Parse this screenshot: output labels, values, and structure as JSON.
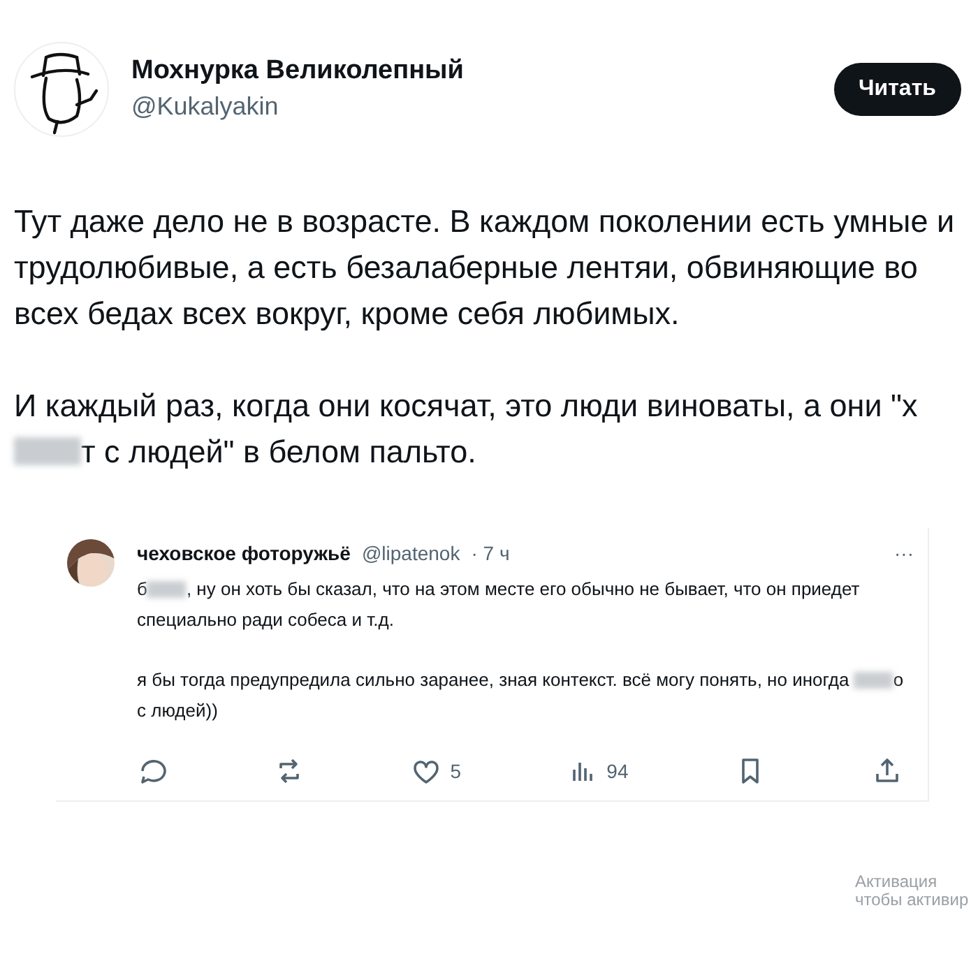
{
  "post": {
    "author": "Мохнурка Великолепный",
    "handle": "@Kukalyakin",
    "follow_button": "Читать",
    "paragraphs": [
      [
        {
          "kind": "text",
          "text": "Тут даже дело не в возрасте. В каждом поколении есть умные и трудолюбивые, а есть безалаберные лентяи, обвиняющие во всех бедах всех вокруг, кроме себя любимых."
        }
      ],
      [
        {
          "kind": "text",
          "text": "И каждый раз, когда они косячат, это люди виноваты, а они \"х"
        },
        {
          "kind": "blur"
        },
        {
          "kind": "text",
          "text": "т с людей\" в белом пальто."
        }
      ]
    ]
  },
  "quoted": {
    "author": "чеховское фоторужьё",
    "handle": "@lipatenok",
    "time": "· 7 ч",
    "more": "···",
    "paragraphs": [
      [
        {
          "kind": "text",
          "text": "б"
        },
        {
          "kind": "blur"
        },
        {
          "kind": "text",
          "text": ", ну он хоть бы сказал, что на этом месте его обычно не бывает, что он приедет специально ради собеса и т.д."
        }
      ],
      [
        {
          "kind": "text",
          "text": "я бы тогда предупредила сильно заранее, зная контекст. всё могу понять, но иногда "
        },
        {
          "kind": "blur"
        },
        {
          "kind": "text",
          "text": "о с людей))"
        }
      ]
    ],
    "actions": [
      {
        "kind": "reply"
      },
      {
        "kind": "repost"
      },
      {
        "kind": "like",
        "count": "5"
      },
      {
        "kind": "views",
        "count": "94"
      },
      {
        "kind": "bookmark"
      },
      {
        "kind": "share"
      }
    ]
  },
  "os_overlay": {
    "title": "Активация",
    "subtitle": "чтобы активир"
  }
}
